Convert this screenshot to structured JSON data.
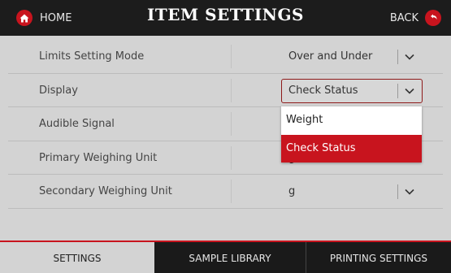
{
  "header": {
    "home_label": "HOME",
    "title": "ITEM SETTINGS",
    "back_label": "BACK"
  },
  "settings": [
    {
      "label": "Limits Setting Mode",
      "value": "Over and Under"
    },
    {
      "label": "Display",
      "value": "Check Status"
    },
    {
      "label": "Audible Signal",
      "value": ""
    },
    {
      "label": "Primary Weighing Unit",
      "value": "g"
    },
    {
      "label": "Secondary Weighing Unit",
      "value": "g"
    }
  ],
  "dropdown": {
    "options": [
      "Weight",
      "Check Status"
    ],
    "selected": "Check Status"
  },
  "tabs": [
    "SETTINGS",
    "SAMPLE LIBRARY",
    "PRINTING SETTINGS"
  ],
  "active_tab": "SETTINGS",
  "colors": {
    "accent": "#c8141e",
    "header_bg": "#1c1c1c",
    "content_bg": "#d3d3d3"
  },
  "icons": {
    "home": "home-icon",
    "back": "back-arrow-icon",
    "chevron": "chevron-down-icon"
  }
}
